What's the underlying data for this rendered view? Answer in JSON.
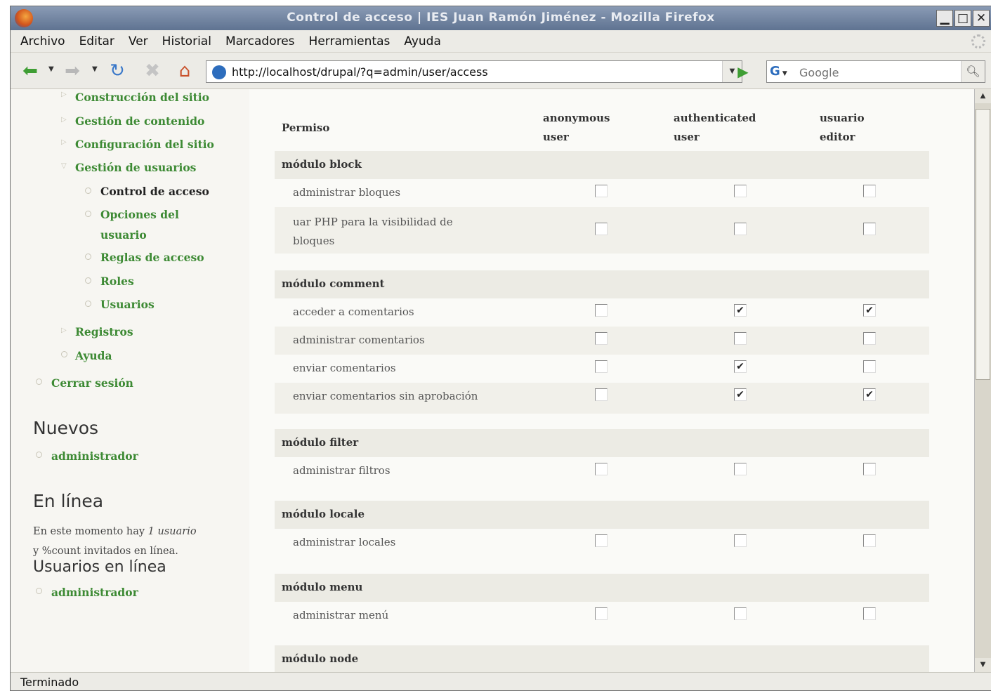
{
  "window": {
    "title": "Control de acceso | IES Juan Ramón Jiménez - Mozilla Firefox",
    "buttons": {
      "minimize": "▁",
      "maximize": "□",
      "close": "✕"
    }
  },
  "menubar": {
    "items": [
      "Archivo",
      "Editar",
      "Ver",
      "Historial",
      "Marcadores",
      "Herramientas",
      "Ayuda"
    ]
  },
  "navbar": {
    "url": "http://localhost/drupal/?q=admin/user/access",
    "search_engine": "G",
    "search_placeholder": "Google",
    "icons": {
      "back": "back-arrow-icon",
      "forward": "forward-arrow-icon",
      "reload": "reload-icon",
      "stop": "stop-icon",
      "home": "home-icon",
      "go": "go-arrow-icon",
      "search": "magnifier-icon"
    }
  },
  "sidebar": {
    "admin_items": [
      {
        "label": "Construcción del sitio"
      },
      {
        "label": "Gestión de contenido"
      },
      {
        "label": "Configuración del sitio"
      },
      {
        "label": "Gestión de usuarios"
      }
    ],
    "user_subitems": [
      {
        "label": "Control de acceso",
        "current": true
      },
      {
        "label": "Opciones del"
      },
      {
        "label": "usuario"
      },
      {
        "label": "Reglas de acceso"
      },
      {
        "label": "Roles"
      },
      {
        "label": "Usuarios"
      }
    ],
    "more_items": [
      {
        "label": "Registros"
      },
      {
        "label": "Ayuda"
      }
    ],
    "logout": "Cerrar sesión",
    "nuevos": {
      "heading": "Nuevos",
      "items": [
        "administrador"
      ]
    },
    "en_linea": {
      "heading": "En línea",
      "text_line1": "En este momento hay",
      "count": "1 usuario",
      "text_line2": "y %count invitados en línea.",
      "subheading": "Usuarios en línea",
      "items": [
        "administrador"
      ]
    }
  },
  "permissions": {
    "header": {
      "permiso": "Permiso",
      "col1_line1": "anonymous",
      "col1_line2": "user",
      "col2_line1": "authenticated",
      "col2_line2": "user",
      "col3_line1": "usuario",
      "col3_line2": "editor"
    },
    "modules": [
      {
        "name": "módulo block",
        "rows": [
          {
            "lines": [
              "administrar bloques"
            ],
            "checks": [
              false,
              false,
              false
            ]
          },
          {
            "lines": [
              "uar PHP para la visibilidad de",
              "bloques"
            ],
            "checks": [
              false,
              false,
              false
            ]
          }
        ]
      },
      {
        "name": "módulo comment",
        "rows": [
          {
            "lines": [
              "acceder a comentarios"
            ],
            "checks": [
              false,
              true,
              true
            ]
          },
          {
            "lines": [
              "administrar comentarios"
            ],
            "checks": [
              false,
              false,
              false
            ]
          },
          {
            "lines": [
              "enviar comentarios"
            ],
            "checks": [
              false,
              true,
              false
            ]
          },
          {
            "lines": [
              "enviar comentarios sin aprobación"
            ],
            "checks": [
              false,
              true,
              true
            ]
          }
        ]
      },
      {
        "name": "módulo filter",
        "rows": [
          {
            "lines": [
              "administrar filtros"
            ],
            "checks": [
              false,
              false,
              false
            ]
          }
        ]
      },
      {
        "name": "módulo locale",
        "rows": [
          {
            "lines": [
              "administrar locales"
            ],
            "checks": [
              false,
              false,
              false
            ]
          }
        ]
      },
      {
        "name": "módulo menu",
        "rows": [
          {
            "lines": [
              "administrar menú"
            ],
            "checks": [
              false,
              false,
              false
            ]
          }
        ]
      },
      {
        "name": "módulo node",
        "rows": []
      }
    ]
  },
  "statusbar": {
    "text": "Terminado"
  },
  "colors": {
    "link": "#3d8a34",
    "titlebar": "#6f82a0",
    "module_row": "#ecebe4"
  }
}
